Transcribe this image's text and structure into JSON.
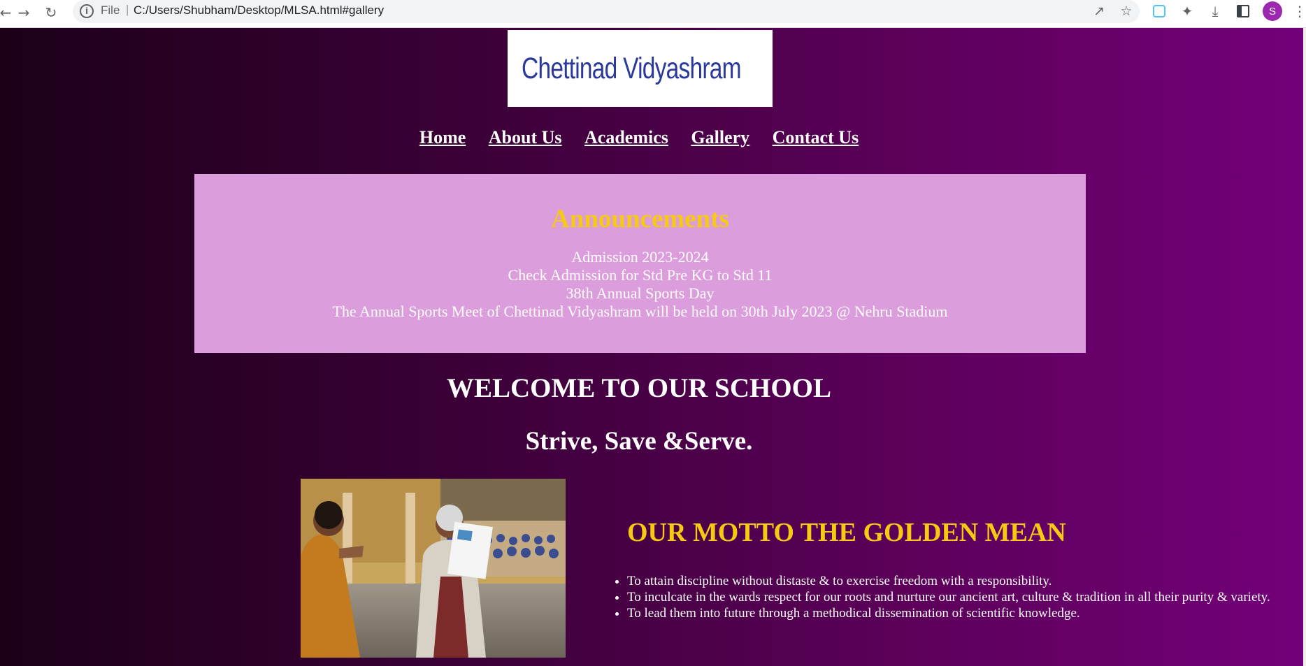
{
  "browser": {
    "back_icon": "arrow-left",
    "forward_icon": "arrow-right",
    "reload_icon": "reload",
    "protocol": "File",
    "url": "C:/Users/Shubham/Desktop/MLSA.html#gallery",
    "profile_initial": "S"
  },
  "header": {
    "logo_text": "Chettinad Vidyashram"
  },
  "nav": {
    "items": [
      "Home",
      "About Us",
      "Academics",
      "Gallery",
      "Contact Us"
    ]
  },
  "announcements": {
    "title": "Announcements",
    "lines": [
      "Admission 2023-2024",
      "Check Admission for Std Pre KG to Std 11",
      "38th Annual Sports Day",
      "The Annual Sports Meet of Chettinad Vidyashram will be held on 30th July 2023 @ Nehru Stadium"
    ]
  },
  "welcome": {
    "heading": "WELCOME TO OUR SCHOOL",
    "slogan": "Strive, Save &Serve."
  },
  "motto": {
    "title": "OUR MOTTO THE GOLDEN MEAN",
    "points": [
      "To attain discipline without distaste & to exercise freedom with a responsibility.",
      "To inculcate in the wards respect for our roots and nurture our ancient art, culture & tradition in all their purity & variety.",
      "To lead them into future through a methodical dissemination of scientific knowledge."
    ]
  },
  "colors": {
    "accent_gold": "#f6c913",
    "announce_bg": "#dc9ddc",
    "gradient_dark": "#1b0018",
    "gradient_light": "#730079"
  }
}
